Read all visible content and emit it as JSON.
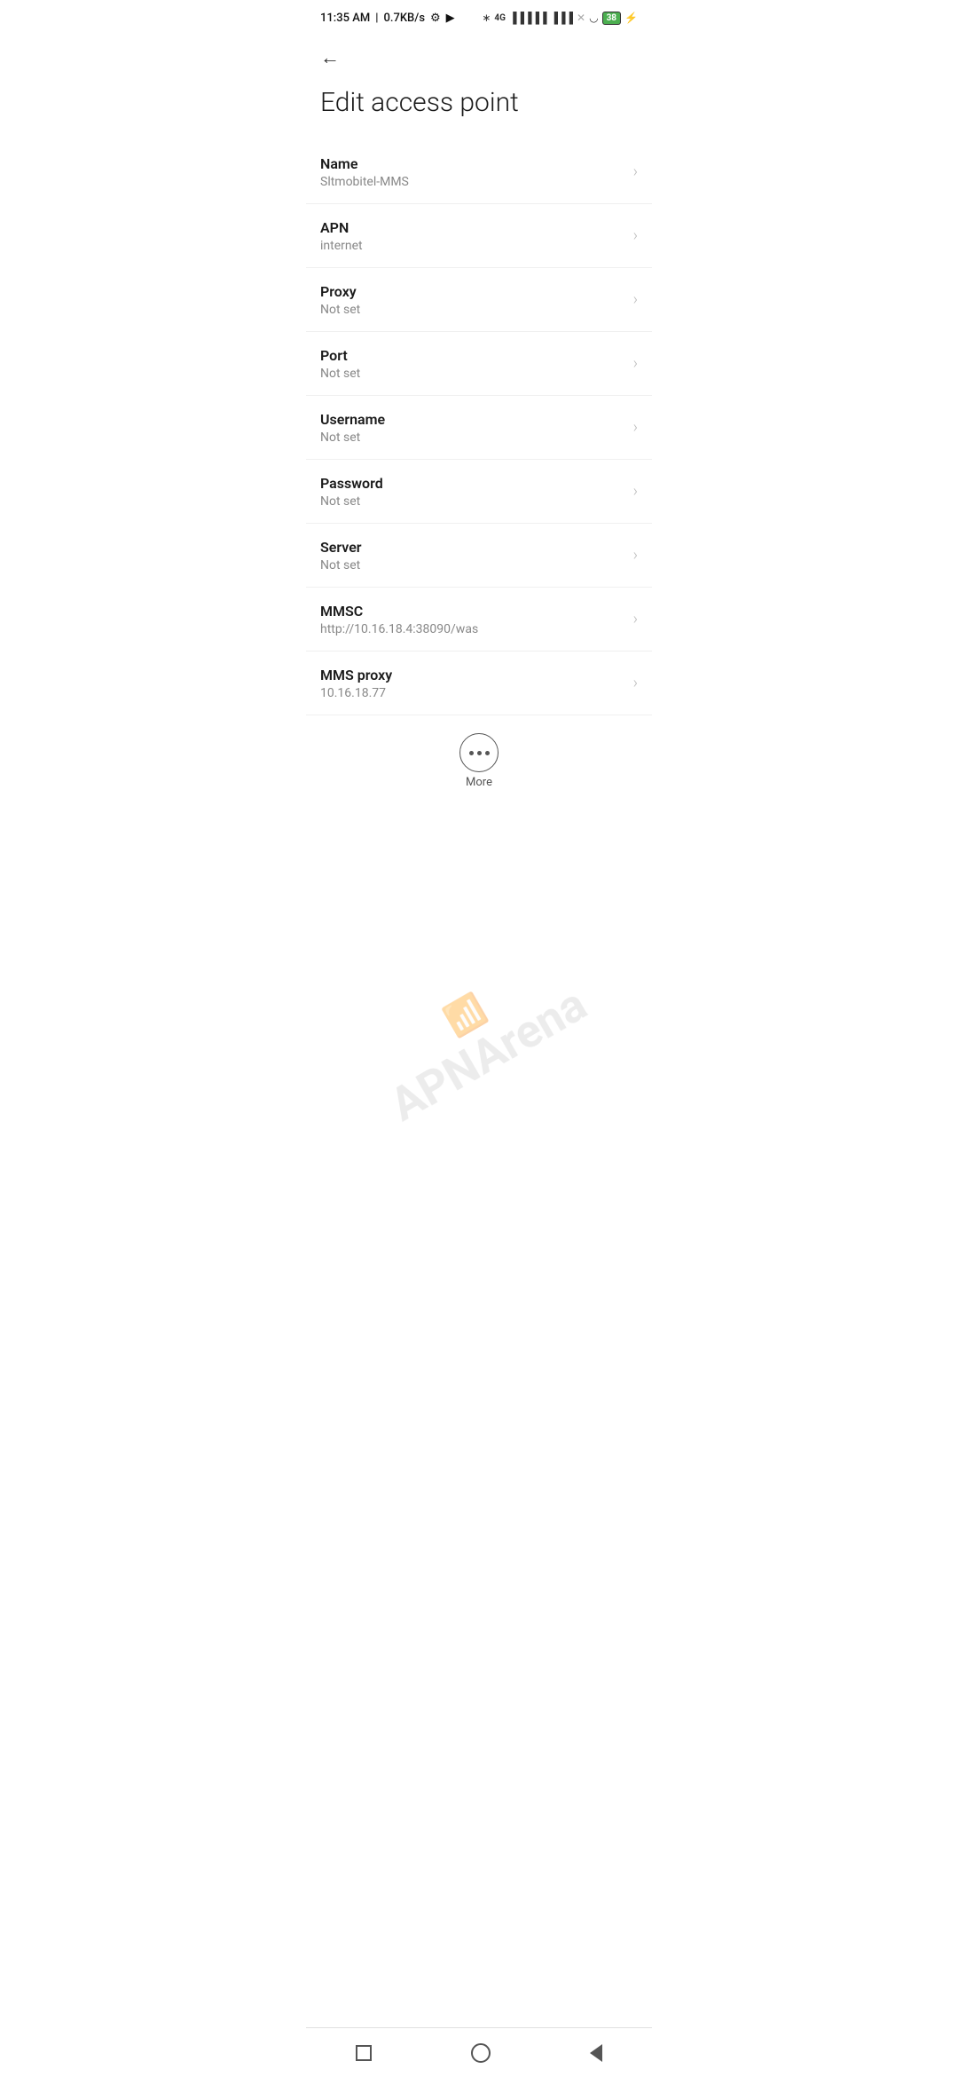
{
  "statusBar": {
    "time": "11:35 AM",
    "speed": "0.7KB/s",
    "battery": "38"
  },
  "header": {
    "backLabel": "←"
  },
  "pageTitle": "Edit access point",
  "settings": [
    {
      "label": "Name",
      "value": "Sltmobitel-MMS"
    },
    {
      "label": "APN",
      "value": "internet"
    },
    {
      "label": "Proxy",
      "value": "Not set"
    },
    {
      "label": "Port",
      "value": "Not set"
    },
    {
      "label": "Username",
      "value": "Not set"
    },
    {
      "label": "Password",
      "value": "Not set"
    },
    {
      "label": "Server",
      "value": "Not set"
    },
    {
      "label": "MMSC",
      "value": "http://10.16.18.4:38090/was"
    },
    {
      "label": "MMS proxy",
      "value": "10.16.18.77"
    }
  ],
  "more": {
    "label": "More"
  },
  "watermark": "APNArena"
}
